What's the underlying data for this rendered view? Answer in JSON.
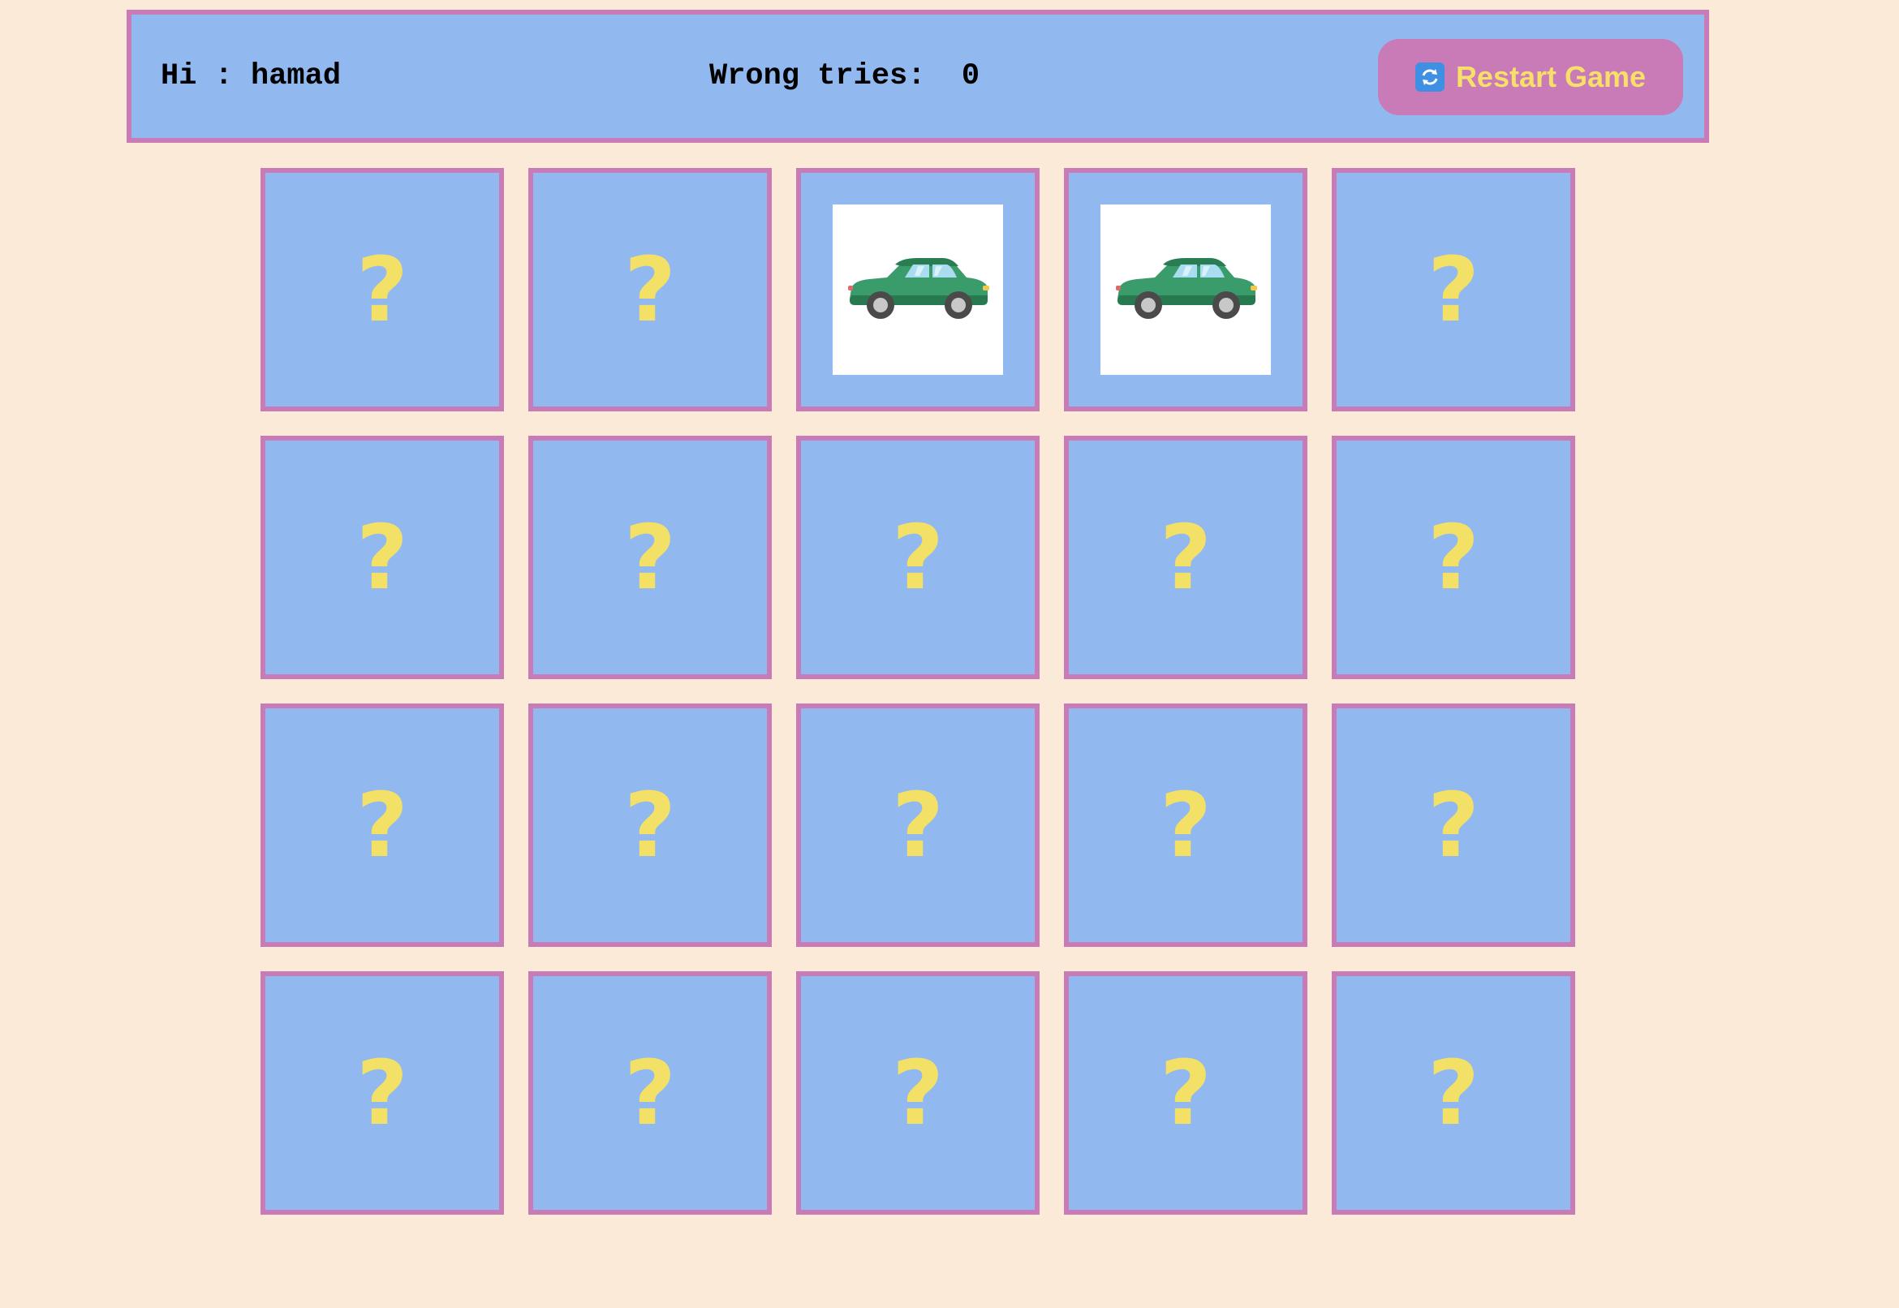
{
  "header": {
    "player_label": "Hi : hamad",
    "wrong_tries_label": "Wrong tries:",
    "wrong_tries_value": "0",
    "restart_label": "Restart Game",
    "restart_icon": "refresh-icon"
  },
  "colors": {
    "background": "#fbead7",
    "panel": "#91b8ef",
    "border": "#c97bb8",
    "question_mark": "#f3e067",
    "button_text": "#f7df6a"
  },
  "board": {
    "rows": 4,
    "columns": 5,
    "hidden_symbol": "?",
    "cards": [
      {
        "state": "hidden"
      },
      {
        "state": "hidden"
      },
      {
        "state": "revealed",
        "image": "green-car"
      },
      {
        "state": "revealed",
        "image": "green-car"
      },
      {
        "state": "hidden"
      },
      {
        "state": "hidden"
      },
      {
        "state": "hidden"
      },
      {
        "state": "hidden"
      },
      {
        "state": "hidden"
      },
      {
        "state": "hidden"
      },
      {
        "state": "hidden"
      },
      {
        "state": "hidden"
      },
      {
        "state": "hidden"
      },
      {
        "state": "hidden"
      },
      {
        "state": "hidden"
      },
      {
        "state": "hidden"
      },
      {
        "state": "hidden"
      },
      {
        "state": "hidden"
      },
      {
        "state": "hidden"
      },
      {
        "state": "hidden"
      }
    ]
  }
}
